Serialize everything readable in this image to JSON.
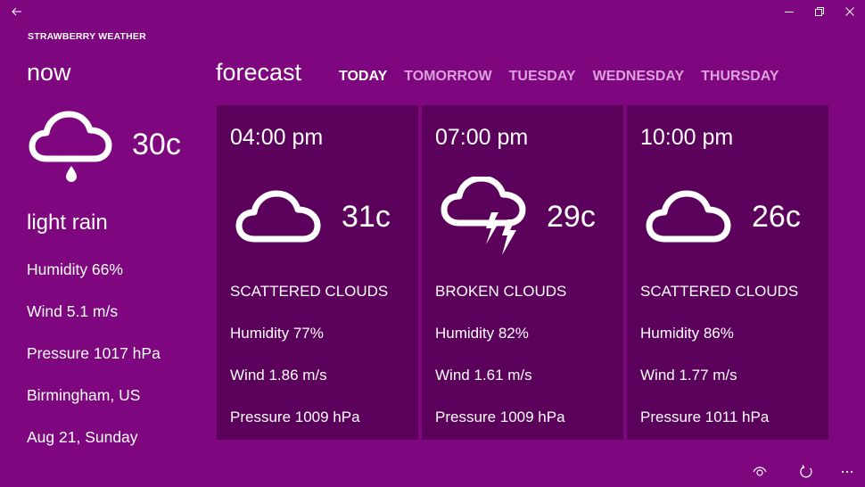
{
  "window": {
    "back_icon": "back-arrow-icon",
    "controls": [
      "minimize-icon",
      "restore-icon",
      "close-icon"
    ]
  },
  "app": {
    "title": "STRAWBERRY WEATHER"
  },
  "now": {
    "heading": "now",
    "icon": "rain-cloud-icon",
    "temperature": "30c",
    "description": "light rain",
    "humidity": "Humidity 66%",
    "wind": "Wind 5.1 m/s",
    "pressure": "Pressure 1017 hPa",
    "location": "Birmingham, US",
    "date": "Aug 21, Sunday"
  },
  "forecast": {
    "heading": "forecast",
    "tabs": [
      {
        "label": "TODAY",
        "active": true
      },
      {
        "label": "TOMORROW",
        "active": false
      },
      {
        "label": "TUESDAY",
        "active": false
      },
      {
        "label": "WEDNESDAY",
        "active": false
      },
      {
        "label": "THURSDAY",
        "active": false
      }
    ],
    "cards": [
      {
        "time": "04:00 pm",
        "icon": "cloud-icon",
        "temperature": "31c",
        "description": "SCATTERED CLOUDS",
        "humidity": "Humidity 77%",
        "wind": "Wind 1.86 m/s",
        "pressure": "Pressure 1009 hPa"
      },
      {
        "time": "07:00 pm",
        "icon": "thunderstorm-cloud-icon",
        "temperature": "29c",
        "description": "BROKEN CLOUDS",
        "humidity": "Humidity 82%",
        "wind": "Wind 1.61 m/s",
        "pressure": "Pressure 1009 hPa"
      },
      {
        "time": "10:00 pm",
        "icon": "cloud-icon",
        "temperature": "26c",
        "description": "SCATTERED CLOUDS",
        "humidity": "Humidity 86%",
        "wind": "Wind 1.77 m/s",
        "pressure": "Pressure 1011 hPa"
      }
    ]
  },
  "app_bar": {
    "icons": [
      "eye-icon",
      "refresh-icon",
      "more-icon"
    ]
  },
  "colors": {
    "background": "#7e067e",
    "card": "#5b005b",
    "inactive_tab": "#dca0dc",
    "text": "#ffffff"
  }
}
